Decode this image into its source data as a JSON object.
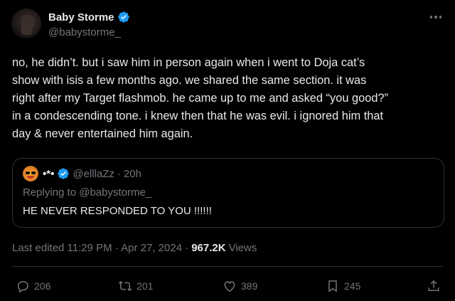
{
  "author": {
    "display_name": "Baby Storme",
    "handle": "@babystorme_"
  },
  "tweet": {
    "text": "no, he didn’t. but i saw him in person again when i went to Doja cat’s\nshow with isis a few months ago. we shared the same section. it was\nright after my Target flashmob. he came up to me and asked “you good?”\nin a condescending tone. i knew then that he was evil. i ignored him that\nday & never entertained him again."
  },
  "quote": {
    "display_name": "•*•",
    "handle": "@elllaZz",
    "separator": "·",
    "time": "20h",
    "replying_prefix": "Replying to",
    "replying_to": "@babystorme_",
    "text": "HE NEVER RESPONDED TO YOU !!!!!!"
  },
  "meta": {
    "edited": "Last edited 11:29 PM · Apr 27, 2024 ·",
    "views_count": "967.2K",
    "views_label": "Views"
  },
  "actions": {
    "replies": "206",
    "reposts": "201",
    "likes": "389",
    "bookmarks": "245"
  },
  "colors": {
    "background": "#000000",
    "text": "#e7e9ea",
    "muted": "#71767b",
    "border": "#2f3336",
    "verified": "#1d9bf0"
  },
  "icons": [
    "more-icon",
    "verified-badge-icon",
    "reply-icon",
    "repost-icon",
    "like-icon",
    "bookmark-icon",
    "share-icon"
  ]
}
